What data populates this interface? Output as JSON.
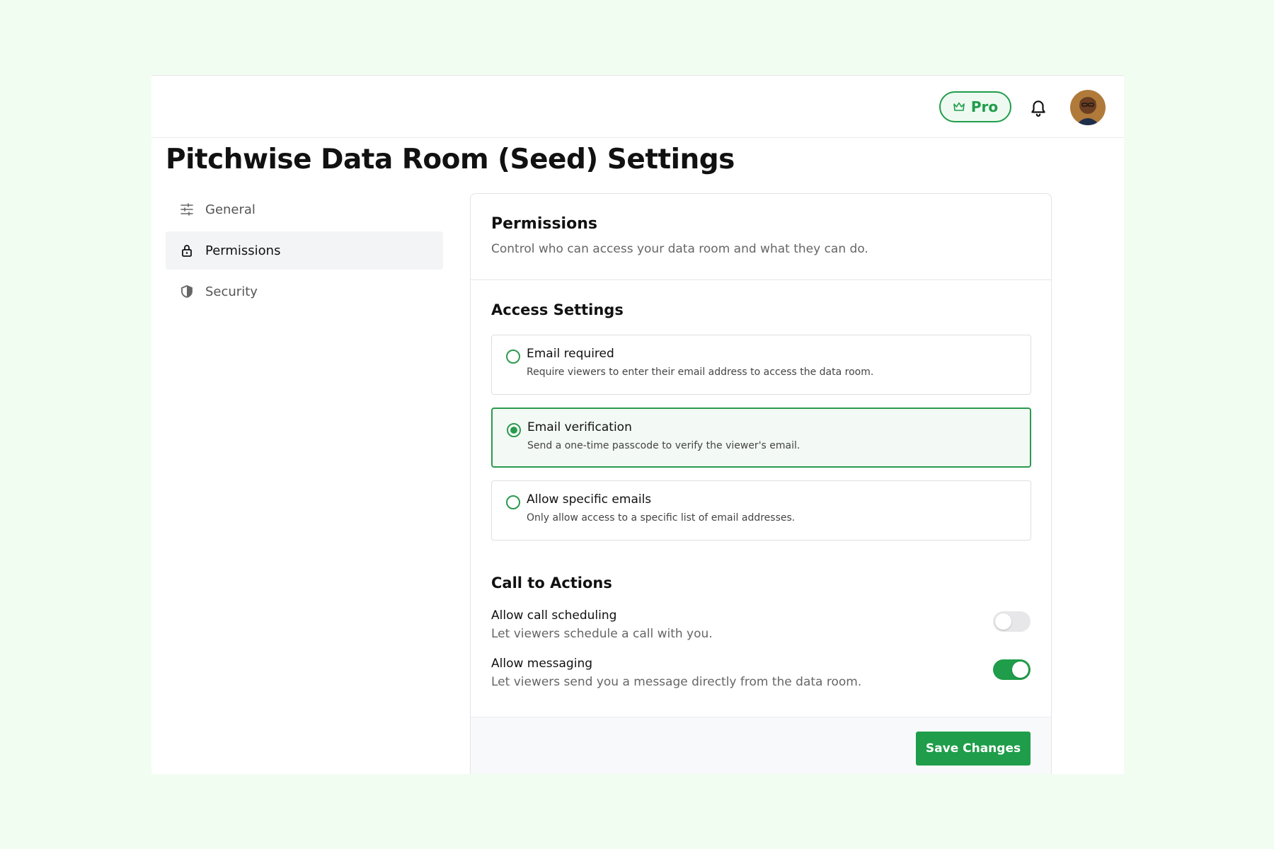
{
  "header": {
    "pro_label": "Pro",
    "icons": [
      "crown-icon",
      "bell-icon",
      "avatar"
    ]
  },
  "page": {
    "title": "Pitchwise Data Room (Seed) Settings"
  },
  "sidebar": {
    "items": [
      {
        "label": "General",
        "icon": "sliders-icon",
        "active": false
      },
      {
        "label": "Permissions",
        "icon": "lock-icon",
        "active": true
      },
      {
        "label": "Security",
        "icon": "shield-icon",
        "active": false
      }
    ]
  },
  "permissions": {
    "title": "Permissions",
    "subtitle": "Control who can access your data room and what they can do.",
    "access": {
      "title": "Access Settings",
      "options": [
        {
          "label": "Email required",
          "description": "Require viewers to enter their email address to access the data room.",
          "selected": false
        },
        {
          "label": "Email verification",
          "description": "Send a one-time passcode to verify the viewer's email.",
          "selected": true
        },
        {
          "label": "Allow specific emails",
          "description": "Only allow access to a specific list of email addresses.",
          "selected": false
        }
      ]
    },
    "cta": {
      "title": "Call to Actions",
      "toggles": [
        {
          "label": "Allow call scheduling",
          "description": "Let viewers schedule a call with you.",
          "on": false
        },
        {
          "label": "Allow messaging",
          "description": "Let viewers send you a message directly from the data room.",
          "on": true
        }
      ]
    },
    "save_label": "Save Changes"
  },
  "colors": {
    "accent": "#1f9d4a",
    "page_bg": "#f2fdf2",
    "selected_bg": "#f3f9f4"
  }
}
